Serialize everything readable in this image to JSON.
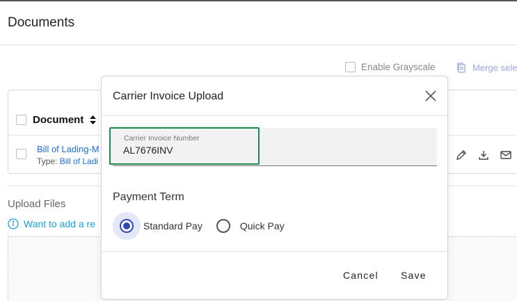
{
  "page": {
    "title": "Documents"
  },
  "toolbar": {
    "grayscale_label": "Enable Grayscale",
    "merge_label": "Merge sele"
  },
  "documents": {
    "header": "Document",
    "rows": [
      {
        "name": "Bill of Lading-M",
        "type_prefix": "Type:",
        "type_value": "Bill of Ladi"
      }
    ]
  },
  "upload": {
    "title": "Upload Files",
    "info": "Want to add a re"
  },
  "modal": {
    "title": "Carrier Invoice Upload",
    "field": {
      "label": "Carrier Invoice Number",
      "value": "AL7676INV"
    },
    "payment_term_label": "Payment Term",
    "options": [
      {
        "label": "Standard Pay",
        "selected": true
      },
      {
        "label": "Quick Pay",
        "selected": false
      }
    ],
    "cancel_label": "Cancel",
    "save_label": "Save"
  },
  "colors": {
    "accent": "#2f49b8",
    "focus": "#1c8a4f",
    "link": "#1e6fd9",
    "info": "#1aa0d8"
  }
}
